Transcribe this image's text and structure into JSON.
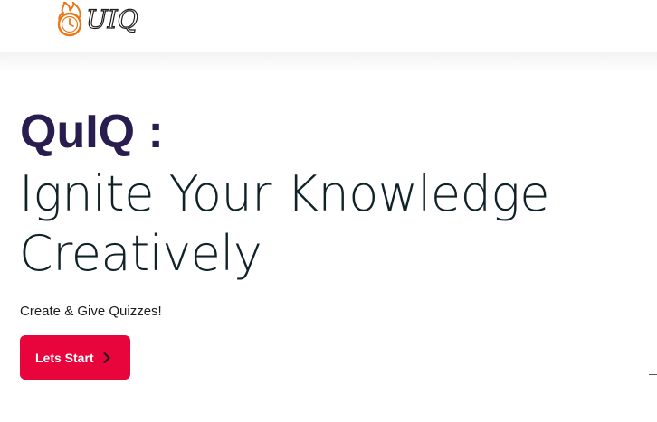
{
  "header": {
    "logo": {
      "text": "UIQ",
      "icon": "flaming-clock-icon",
      "colors": {
        "flame": "#e8791a",
        "outline": "#1e1e1e"
      }
    }
  },
  "hero": {
    "brand": "QuIQ :",
    "tagline": "Ignite Your Knowledge Creatively",
    "subtitle": "Create & Give Quizzes!",
    "cta": {
      "label": "Lets Start",
      "icon": "chevron-right-icon"
    }
  },
  "colors": {
    "brand_text": "#291c4f",
    "tagline_text": "#102228",
    "cta_background": "#e8053c",
    "cta_text": "#ffffff"
  }
}
